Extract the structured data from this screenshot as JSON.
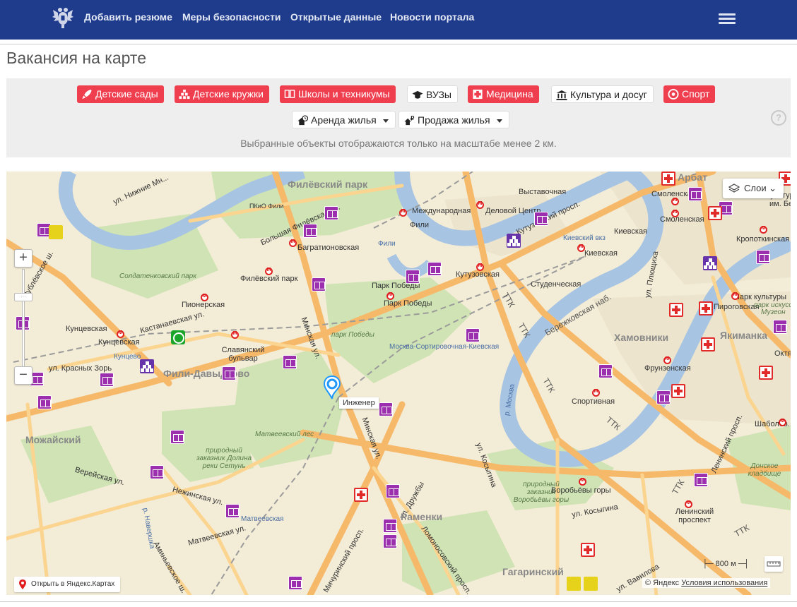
{
  "nav": {
    "links": [
      "Добавить резюме",
      "Меры безопасности",
      "Открытые данные",
      "Новости портала"
    ]
  },
  "page": {
    "title": "Вакансия на карте"
  },
  "filters": {
    "chips": [
      {
        "label": "Детские сады",
        "icon": "rocket-icon",
        "style": "red"
      },
      {
        "label": "Детские кружки",
        "icon": "blocks-icon",
        "style": "red"
      },
      {
        "label": "Школы и техникумы",
        "icon": "book-icon",
        "style": "red"
      },
      {
        "label": "ВУЗы",
        "icon": "graduation-cap-icon",
        "style": "white"
      },
      {
        "label": "Медицина",
        "icon": "medical-cross-icon",
        "style": "red"
      },
      {
        "label": "Культура и досуг",
        "icon": "museum-icon",
        "style": "white"
      },
      {
        "label": "Спорт",
        "icon": "ball-icon",
        "style": "red"
      }
    ],
    "selects": [
      {
        "label": "Аренда жилья",
        "icon": "house-clock-icon"
      },
      {
        "label": "Продажа жилья",
        "icon": "house-ruble-icon"
      }
    ],
    "help": "?",
    "note": "Выбранные объекты отображаются только на масштабе менее 2 км."
  },
  "map": {
    "layers_label": "Слои",
    "marker_label": "Инженер",
    "open_in_yandex": "Открыть в Яндекс.Картах",
    "scale_label": "800 м",
    "copyright": "© Яндекс",
    "terms": "Условия использования",
    "labels": {
      "filevsky_park": "Филёвский парк",
      "arbat": "Арбат",
      "nizhnie_mnevniki": "ул. Нижние Мн...",
      "pkio_fili": "ПКиО Фили",
      "mezhdunarodnaya": "Международная",
      "vystavochnaya": "Выставочная",
      "delovoy_tsentr": "Деловой Центр",
      "smolenskaya1": "Смоленская",
      "smolenskaya2": "Смоленская",
      "fili": "Фили",
      "fili_small": "Фили",
      "bolshaya_filevskaya": "Большая Филёвская ул.",
      "bagrationovskaya": "Багратионовская",
      "kutuzovsky": "Кутузовский просп.",
      "kievskaya1": "Киевская",
      "kievskiy_vokzal": "Киевский вкз",
      "kievskaya2": "Киевская",
      "kropotkinskaya": "Кропоткинская",
      "soldatenkovsky": "Солдатенковский парк",
      "filevsky_park_st": "Филёвский парк",
      "park_pobedy1": "Парк Победы",
      "park_pobedy2": "Парк Победы",
      "kutuzovskaya": "Кутузовская",
      "studencheskaya": "Студенческая",
      "rublevskoe": "Рублёвское ш.",
      "pionerskaya": "Пионерская",
      "kuntsevskaya1": "Кунцевская",
      "kuntsevskaya2": "Кунцевская",
      "kastanaevskaya": "Кастанаевская ул.",
      "slavyansky": "Славянский бульвар",
      "minskaya1": "Минская ул.",
      "park_pobedy_park": "парк Победы",
      "moskva_sort": "Москва-Сортировочная-Киевская",
      "berezhkovskaya": "Бережковская наб.",
      "khamovniki": "Хамовники",
      "yakimanka": "Якиманка",
      "frunzenskaya": "Фрунзенская",
      "park_kultury": "Парк культуры",
      "kuntsevo": "Кунцево",
      "krasnykh_zor": "ул. Красных Зорь",
      "fili_davydkovo": "Фили-Давыдково",
      "mozhaysky": "Можайский",
      "matveevsky_les": "Матвеевский лес",
      "minskaya2": "Минская ул.",
      "kosygina1": "ул. Косыгина",
      "sportivnaya": "Спортивная",
      "ttk1": "ТТК",
      "ttk2": "ТТК",
      "ttk3": "ТТК",
      "ttk4": "ТТК",
      "ttk5": "ТТК",
      "ttk6": "ТТК",
      "moskva_river": "р. Москва",
      "setun": "природный заказник Долина реки Сетунь",
      "vereyskaya": "Верейская ул.",
      "nezhinskaya": "Нежинская ул.",
      "navershka": "р. Навершка",
      "matveevskaya_st": "Матвеевская",
      "matveevskaya_ul": "Матвеевская ул.",
      "druzhby": "ул. Дружбы",
      "ramenki": "Раменки",
      "lomonosovsky": "Ломоносовский просп.",
      "michurinsky": "Мичуринский просп.",
      "aminevskoe": "Аминьевское ш.",
      "vorobyovy_gory_zak": "природный заказник Воробьёвы горы",
      "vorobyovy_gory": "Воробьёвы горы",
      "kosygina2": "ул. Косыгина",
      "gagarinsky": "Гагаринский",
      "leninsky": "Ленинский просп.",
      "leninsky_st": "Ленинский проспект",
      "shabolovskaya": "Шаболов...",
      "donskoe": "Донское кладбище",
      "oktyabrskaya": "Октяб...",
      "plyushchikha": "ул. Плющиха",
      "pirogovskaya": "Пироговская",
      "muzeon": "Музеон",
      "park_iskusstv": "парк искусств",
      "kultury": "Культуры",
      "im_bel": "им. Бел...",
      "fili_link": "Фили",
      "vavilova": "ул. Вавилова"
    }
  }
}
